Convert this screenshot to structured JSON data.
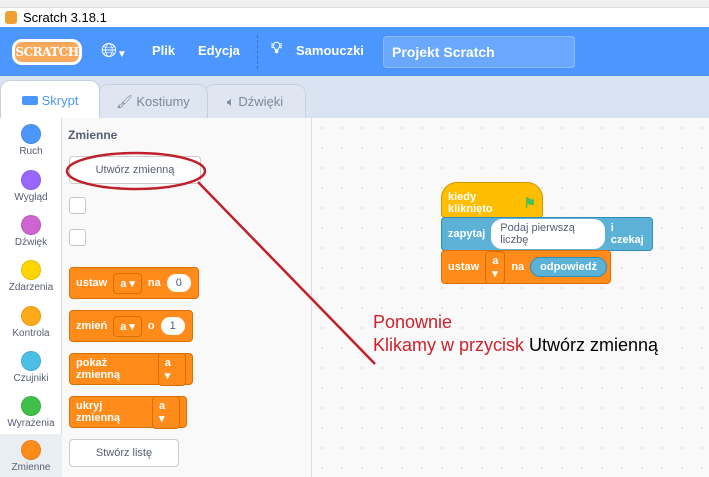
{
  "window": {
    "title": "Scratch 3.18.1"
  },
  "menubar": {
    "logo": "SCRATCH",
    "language_icon": "globe-icon",
    "file": "Plik",
    "edit": "Edycja",
    "tutorials": "Samouczki",
    "project_title": "Projekt Scratch"
  },
  "tabs": [
    {
      "label": "Skrypt",
      "icon": "code-icon"
    },
    {
      "label": "Kostiumy",
      "icon": "brush-icon"
    },
    {
      "label": "Dźwięki",
      "icon": "speaker-icon"
    }
  ],
  "categories": [
    {
      "label": "Ruch",
      "color": "#4c97ff"
    },
    {
      "label": "Wygląd",
      "color": "#9966ff"
    },
    {
      "label": "Dźwięk",
      "color": "#cf63cf"
    },
    {
      "label": "Zdarzenia",
      "color": "#ffd500"
    },
    {
      "label": "Kontrola",
      "color": "#ffab19"
    },
    {
      "label": "Czujniki",
      "color": "#4cbfe6"
    },
    {
      "label": "Wyrażenia",
      "color": "#40bf4a"
    },
    {
      "label": "Zmienne",
      "color": "#ff8c1a"
    }
  ],
  "palette": {
    "title": "Zmienne",
    "make_variable": "Utwórz zmienną",
    "blocks": {
      "set": {
        "label": "ustaw",
        "var": "a",
        "word": "na",
        "value": "0"
      },
      "change": {
        "label": "zmień",
        "var": "a",
        "word": "o",
        "value": "1"
      },
      "show": {
        "label": "pokaż zmienną",
        "var": "a"
      },
      "hide": {
        "label": "ukryj zmienną",
        "var": "a"
      }
    },
    "make_list": "Stwórz listę"
  },
  "script": {
    "hat": "kiedy kliknięto",
    "ask": {
      "label": "zapytaj",
      "text": "Podaj pierwszą liczbę",
      "suffix": "i czekaj"
    },
    "set": {
      "label": "ustaw",
      "var": "a",
      "word": "na",
      "reporter": "odpowiedź"
    }
  },
  "annotation": {
    "line1": "Ponownie",
    "line2_red": "Klikamy w przycisk",
    "line2_black": "Utwórz zmienną",
    "color": "#d0202a"
  }
}
